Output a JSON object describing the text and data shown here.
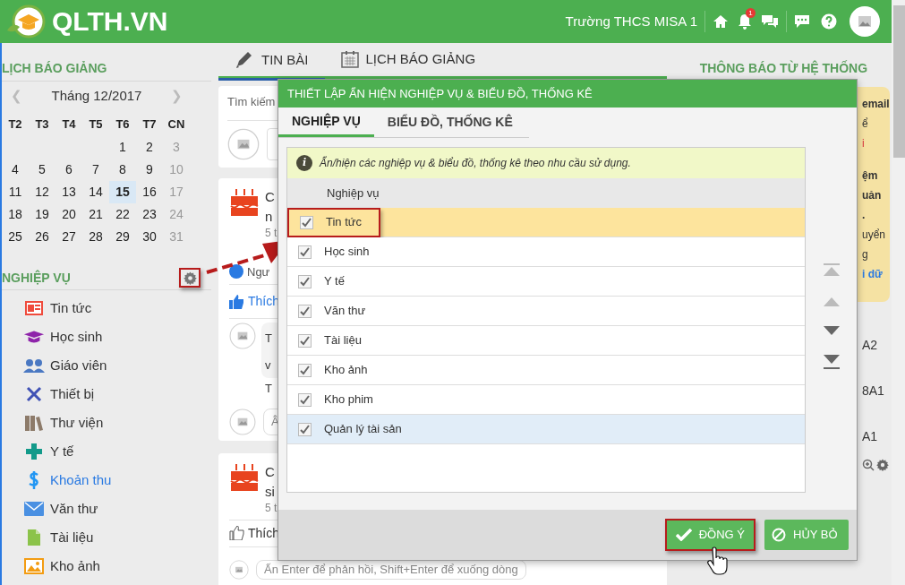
{
  "header": {
    "logo": "QLTH.VN",
    "school": "Trường THCS MISA 1",
    "notification_count": "1"
  },
  "calendar": {
    "title": "LỊCH BÁO GIẢNG",
    "prev": "❮",
    "month": "Tháng 12/2017",
    "next": "❯",
    "weekdays": [
      "T2",
      "T3",
      "T4",
      "T5",
      "T6",
      "T7",
      "CN"
    ],
    "weeks": [
      [
        {
          "day": "1",
          "selected": false
        },
        {
          "day": "2",
          "selected": false
        },
        {
          "day": "3",
          "selected": false
        }
      ],
      [
        {
          "day": "4",
          "selected": false
        },
        {
          "day": "5",
          "selected": false
        },
        {
          "day": "6",
          "selected": false
        },
        {
          "day": "7",
          "selected": false
        },
        {
          "day": "8",
          "selected": false
        },
        {
          "day": "9",
          "selected": false
        },
        {
          "day": "10",
          "selected": false
        }
      ],
      [
        {
          "day": "11",
          "selected": false
        },
        {
          "day": "12",
          "selected": false
        },
        {
          "day": "13",
          "selected": false
        },
        {
          "day": "14",
          "selected": false
        },
        {
          "day": "15",
          "selected": true
        },
        {
          "day": "16",
          "selected": false
        },
        {
          "day": "17",
          "selected": false
        }
      ],
      [
        {
          "day": "18",
          "selected": false
        },
        {
          "day": "19",
          "selected": false
        },
        {
          "day": "20",
          "selected": false
        },
        {
          "day": "21",
          "selected": false
        },
        {
          "day": "22",
          "selected": false
        },
        {
          "day": "23",
          "selected": false
        },
        {
          "day": "24",
          "selected": false
        }
      ],
      [
        {
          "day": "25",
          "selected": false
        },
        {
          "day": "26",
          "selected": false
        },
        {
          "day": "27",
          "selected": false
        },
        {
          "day": "28",
          "selected": false
        },
        {
          "day": "29",
          "selected": false
        },
        {
          "day": "30",
          "selected": false
        },
        {
          "day": "31",
          "selected": false
        }
      ]
    ]
  },
  "modules": {
    "title": "NGHIỆP VỤ",
    "items": [
      {
        "label": "Tin tức",
        "selected": false
      },
      {
        "label": "Học sinh",
        "selected": false
      },
      {
        "label": "Giáo viên",
        "selected": false
      },
      {
        "label": "Thiết bị",
        "selected": false
      },
      {
        "label": "Thư viện",
        "selected": false
      },
      {
        "label": "Y tế",
        "selected": false
      },
      {
        "label": "Khoản thu",
        "selected": true
      },
      {
        "label": "Văn thư",
        "selected": false
      },
      {
        "label": "Tài liệu",
        "selected": false
      },
      {
        "label": "Kho ảnh",
        "selected": false
      }
    ]
  },
  "tabs": [
    {
      "label": "TIN BÀI",
      "selected": true
    },
    {
      "label": "LỊCH BÁO GIẢNG",
      "selected": false
    }
  ],
  "feed": {
    "search": "Tìm kiếm",
    "post_1": {
      "title_1": "C",
      "title_2": "n",
      "time": "5 t",
      "likers": "Ngư",
      "like": "Thích",
      "comment_1": "T",
      "comment_2": "v",
      "reply": "T",
      "input": "Â"
    },
    "post_2": {
      "title_1": "C",
      "title_2": "si",
      "time": "5 t",
      "like": "Thích",
      "input_placeholder": "Ấn Enter để phản hồi, Shift+Enter để xuống dòng"
    }
  },
  "system": {
    "title": "THÔNG BÁO TỪ HỆ THỐNG",
    "notice": [
      {
        "text": "email",
        "kind": "bold"
      },
      {
        "text": "ể",
        "kind": "plain"
      },
      {
        "text": "i",
        "kind": "red"
      },
      {
        "text": "ệm",
        "kind": "bold"
      },
      {
        "text": "uản",
        "kind": "bold"
      },
      {
        "text": ".",
        "kind": "bold"
      },
      {
        "text": "uyển",
        "kind": "plain"
      },
      {
        "text": "g",
        "kind": "plain"
      },
      {
        "text": "i dữ",
        "kind": "link"
      }
    ],
    "classes": [
      "A2",
      "8A1",
      "A1"
    ]
  },
  "dialog": {
    "title": "THIẾT LẬP ẨN HIỆN NGHIỆP VỤ & BIỂU ĐỒ, THỐNG KÊ",
    "tabs": [
      {
        "label": "NGHIỆP VỤ",
        "selected": true
      },
      {
        "label": "BIỂU ĐỒ, THỐNG KÊ",
        "selected": false
      }
    ],
    "info_icon": "i",
    "info": "Ẩn/hiện các nghiệp vụ & biểu đồ, thống kê theo nhu cầu sử dụng.",
    "column": "Nghiệp vụ",
    "rows": [
      {
        "label": "Tin tức",
        "checked": true,
        "selected": true,
        "hovered": false
      },
      {
        "label": "Học sinh",
        "checked": true,
        "selected": false,
        "hovered": false
      },
      {
        "label": "Y tế",
        "checked": true,
        "selected": false,
        "hovered": false
      },
      {
        "label": "Văn thư",
        "checked": true,
        "selected": false,
        "hovered": false
      },
      {
        "label": "Tài liệu",
        "checked": true,
        "selected": false,
        "hovered": false
      },
      {
        "label": "Kho ảnh",
        "checked": true,
        "selected": false,
        "hovered": false
      },
      {
        "label": "Kho phim",
        "checked": true,
        "selected": false,
        "hovered": false
      },
      {
        "label": "Quản lý tài sản",
        "checked": true,
        "selected": false,
        "hovered": true
      }
    ],
    "confirm": "ĐỒNG Ý",
    "cancel": "HỦY BỎ"
  }
}
